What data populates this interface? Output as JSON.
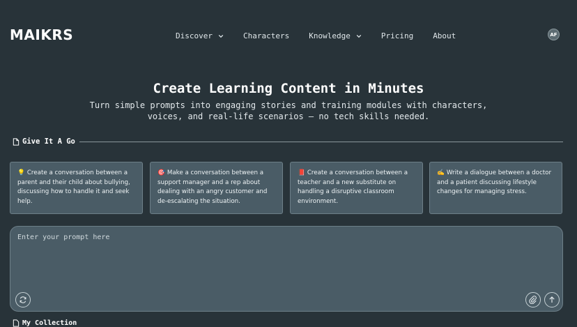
{
  "brand": {
    "logo": "MAIKRS"
  },
  "nav": {
    "items": [
      {
        "label": "Discover",
        "has_dropdown": true
      },
      {
        "label": "Characters",
        "has_dropdown": false
      },
      {
        "label": "Knowledge",
        "has_dropdown": true
      },
      {
        "label": "Pricing",
        "has_dropdown": false
      },
      {
        "label": "About",
        "has_dropdown": false
      }
    ],
    "avatar_initials": "AF"
  },
  "hero": {
    "title": "Create Learning Content in Minutes",
    "subtitle_line1": "Turn simple prompts into engaging stories and training modules with characters,",
    "subtitle_line2": "voices, and real-life scenarios – no tech skills needed."
  },
  "section": {
    "label": "Give It A Go",
    "icon": "document-icon"
  },
  "examples": [
    {
      "emoji": "💡",
      "text": "Create a conversation between a parent and their child about bullying, discussing how to handle it and seek help."
    },
    {
      "emoji": "🎯",
      "text": "Make a conversation between a support manager and a rep about dealing with an angry customer and de-escalating the situation."
    },
    {
      "emoji": "📕",
      "text": "Create a conversation between a teacher and a new substitute on handling a disruptive classroom environment."
    },
    {
      "emoji": "✍️",
      "text": "Write a dialogue between a doctor and a patient discussing lifestyle changes for managing stress."
    }
  ],
  "prompt": {
    "placeholder": "Enter your prompt here",
    "value": "",
    "icons": {
      "left": "refresh-icon",
      "attach": "paperclip-icon",
      "submit": "arrow-up-icon"
    }
  },
  "bottom_section": {
    "label": "My Collection"
  },
  "colors": {
    "background": "#283339",
    "card": "#4a5c66",
    "border": "#6d7f88"
  }
}
